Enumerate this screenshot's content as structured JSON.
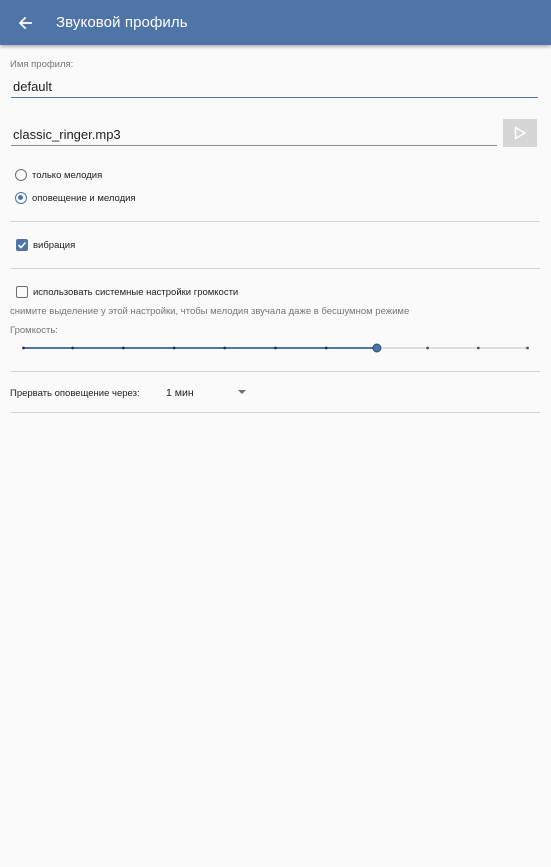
{
  "appbar": {
    "title": "Звуковой профиль",
    "color": "#4e74a8"
  },
  "profile_name": {
    "label": "Имя профиля:",
    "value": "default"
  },
  "melody": {
    "file": "classic_ringer.mp3",
    "play_icon": "play-icon"
  },
  "mode": {
    "options": [
      "только мелодия",
      "оповещение и мелодия"
    ],
    "selected_index": 1
  },
  "vibration": {
    "label": "вибрация",
    "checked": true
  },
  "system_volume": {
    "label": "использовать системные настройки громкости",
    "checked": false,
    "hint": "снимите выделение у этой настройки, чтобы мелодия звучала даже в бесшумном режиме"
  },
  "volume": {
    "label": "Громкость:",
    "steps": 11,
    "level_step": 7
  },
  "interrupt": {
    "label": "Прервать оповещение через:",
    "value": "1 мин"
  }
}
